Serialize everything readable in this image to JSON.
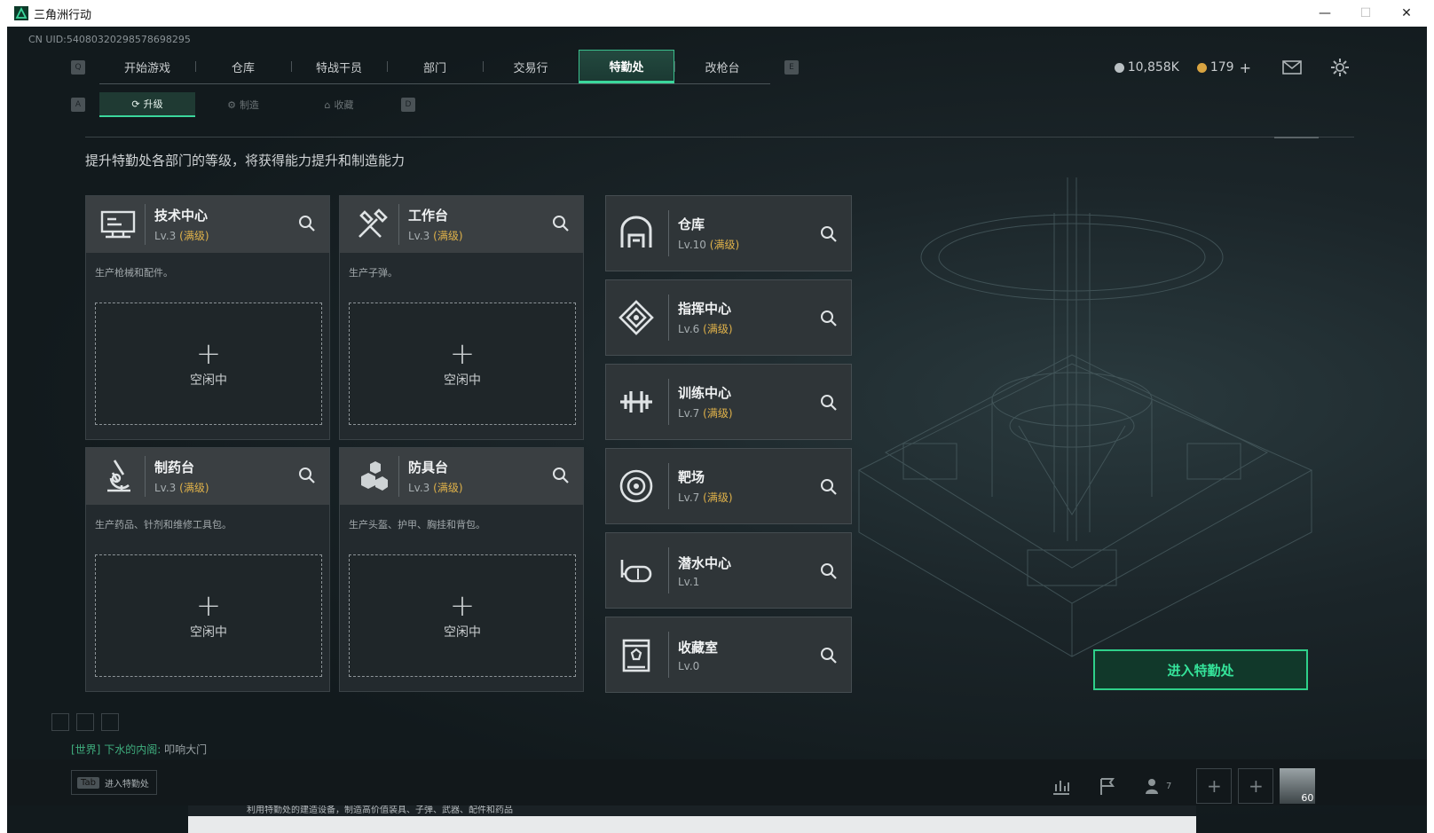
{
  "window": {
    "title": "三角洲行动",
    "minimize": "—",
    "maximize": "☐",
    "close": "✕"
  },
  "uid": "CN UID:54080320298578698295",
  "topnav": {
    "key_left": "Q",
    "key_right": "E",
    "tabs": [
      "开始游戏",
      "仓库",
      "特战干员",
      "部门",
      "交易行",
      "特勤处",
      "改枪台"
    ],
    "active": "特勤处"
  },
  "currency": {
    "hafu_coin": "10,858K",
    "gold": "179",
    "gold_add": "+"
  },
  "subnav": {
    "key_left": "A",
    "key_right": "D",
    "tabs": [
      "升级",
      "制造",
      "收藏"
    ],
    "active": "升级"
  },
  "description": "提升特勤处各部门的等级，将获得能力提升和制造能力",
  "production_cards": [
    {
      "name": "技术中心",
      "level": "Lv.3",
      "status": "(满级)",
      "desc": "生产枪械和配件。",
      "slot_plus": "+",
      "slot_label": "空闲中",
      "icon": "monitor-icon"
    },
    {
      "name": "工作台",
      "level": "Lv.3",
      "status": "(满级)",
      "desc": "生产子弹。",
      "slot_plus": "+",
      "slot_label": "空闲中",
      "icon": "tools-icon"
    },
    {
      "name": "制药台",
      "level": "Lv.3",
      "status": "(满级)",
      "desc": "生产药品、针剂和维修工具包。",
      "slot_plus": "+",
      "slot_label": "空闲中",
      "icon": "microscope-icon"
    },
    {
      "name": "防具台",
      "level": "Lv.3",
      "status": "(满级)",
      "desc": "生产头盔、护甲、胸挂和背包。",
      "slot_plus": "+",
      "slot_label": "空闲中",
      "icon": "armor-icon"
    }
  ],
  "facility_cards": [
    {
      "name": "仓库",
      "level": "Lv.10",
      "status": "(满级)",
      "icon": "warehouse-icon"
    },
    {
      "name": "指挥中心",
      "level": "Lv.6",
      "status": "(满级)",
      "icon": "command-icon"
    },
    {
      "name": "训练中心",
      "level": "Lv.7",
      "status": "(满级)",
      "icon": "dumbbell-icon"
    },
    {
      "name": "靶场",
      "level": "Lv.7",
      "status": "(满级)",
      "icon": "target-icon"
    },
    {
      "name": "潜水中心",
      "level": "Lv.1",
      "status": "",
      "icon": "diving-mask-icon"
    },
    {
      "name": "收藏室",
      "level": "Lv.0",
      "status": "",
      "icon": "vault-icon"
    }
  ],
  "enter_button": "进入特勤处",
  "chat": {
    "channel": "[世界]",
    "user": "下水的内阁:",
    "message": "叩响大门"
  },
  "bottom": {
    "tab_key": "Tab",
    "tab_label": "进入特勤处",
    "friends_count": "7",
    "avatar_level": "60"
  },
  "tooltip_text": "利用特勤处的建造设备，制造高价值装具、子弹、武器、配件和药品",
  "colors": {
    "accent": "#3bd79c",
    "max_level": "#e0b24a",
    "bg": "#141b1f"
  }
}
